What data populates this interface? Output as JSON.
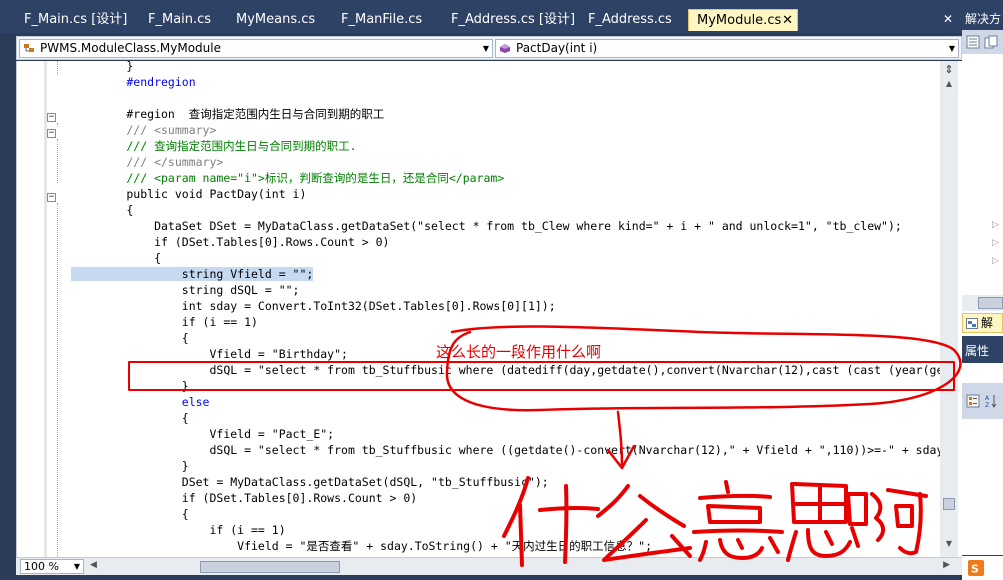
{
  "tabs": [
    {
      "label": "F_Main.cs [设计]",
      "active": false
    },
    {
      "label": "F_Main.cs",
      "active": false
    },
    {
      "label": "MyMeans.cs",
      "active": false
    },
    {
      "label": "F_ManFile.cs",
      "active": false
    },
    {
      "label": "F_Address.cs [设计]",
      "active": false
    },
    {
      "label": "F_Address.cs",
      "active": false
    },
    {
      "label": "MyModule.cs",
      "active": true,
      "close": "✕"
    }
  ],
  "tab_close_all": "✕",
  "nav": {
    "class_combo": "PWMS.ModuleClass.MyModule",
    "member_combo": "PactDay(int i)"
  },
  "code_lines": [
    {
      "t": "        }"
    },
    {
      "t": "        #endregion"
    },
    {
      "t": ""
    },
    {
      "t": "        #region  查询指定范围内生日与合同到期的职工"
    },
    {
      "t": "        /// <summary>"
    },
    {
      "t": "        /// 查询指定范围内生日与合同到期的职工."
    },
    {
      "t": "        /// </summary>"
    },
    {
      "t": "        /// <param name=\"i\">标识，判断查询的是生日，还是合同</param>"
    },
    {
      "t": "        public void PactDay(int i)"
    },
    {
      "t": "        {"
    },
    {
      "t": "            DataSet DSet = MyDataClass.getDataSet(\"select * from tb_Clew where kind=\" + i + \" and unlock=1\", \"tb_clew\");"
    },
    {
      "t": "            if (DSet.Tables[0].Rows.Count > 0)"
    },
    {
      "t": "            {"
    },
    {
      "t": "                string Vfield = \"\";"
    },
    {
      "t": "                string dSQL = \"\";"
    },
    {
      "t": "                int sday = Convert.ToInt32(DSet.Tables[0].Rows[0][1]);"
    },
    {
      "t": "                if (i == 1)"
    },
    {
      "t": "                {"
    },
    {
      "t": "                    Vfield = \"Birthday\";"
    },
    {
      "t": "                    dSQL = \"select * from tb_Stuffbusic where (datediff(day,getdate(),convert(Nvarchar(12),cast (cast (year(getdate()"
    },
    {
      "t": "                }"
    },
    {
      "t": "                else"
    },
    {
      "t": "                {"
    },
    {
      "t": "                    Vfield = \"Pact_E\";"
    },
    {
      "t": "                    dSQL = \"select * from tb_Stuffbusic where ((getdate()-convert(Nvarchar(12),\" + Vfield + \",110))>=-\" + sday + \" and"
    },
    {
      "t": "                }"
    },
    {
      "t": "                DSet = MyDataClass.getDataSet(dSQL, \"tb_Stuffbusic\");"
    },
    {
      "t": "                if (DSet.Tables[0].Rows.Count > 0)"
    },
    {
      "t": "                {"
    },
    {
      "t": "                    if (i == 1)"
    },
    {
      "t": "                        Vfield = \"是否查看\" + sday.ToString() + \"天内过生日的职工信息？\";"
    }
  ],
  "zoom": "100 %",
  "right_panel": {
    "solution_title": "解决方",
    "solution_tab": "解",
    "properties_title": "属性"
  },
  "annotation": {
    "top_text": "这么长的一段作用什么啊",
    "big_text": "什么意思啊",
    "color": "#e80000"
  }
}
